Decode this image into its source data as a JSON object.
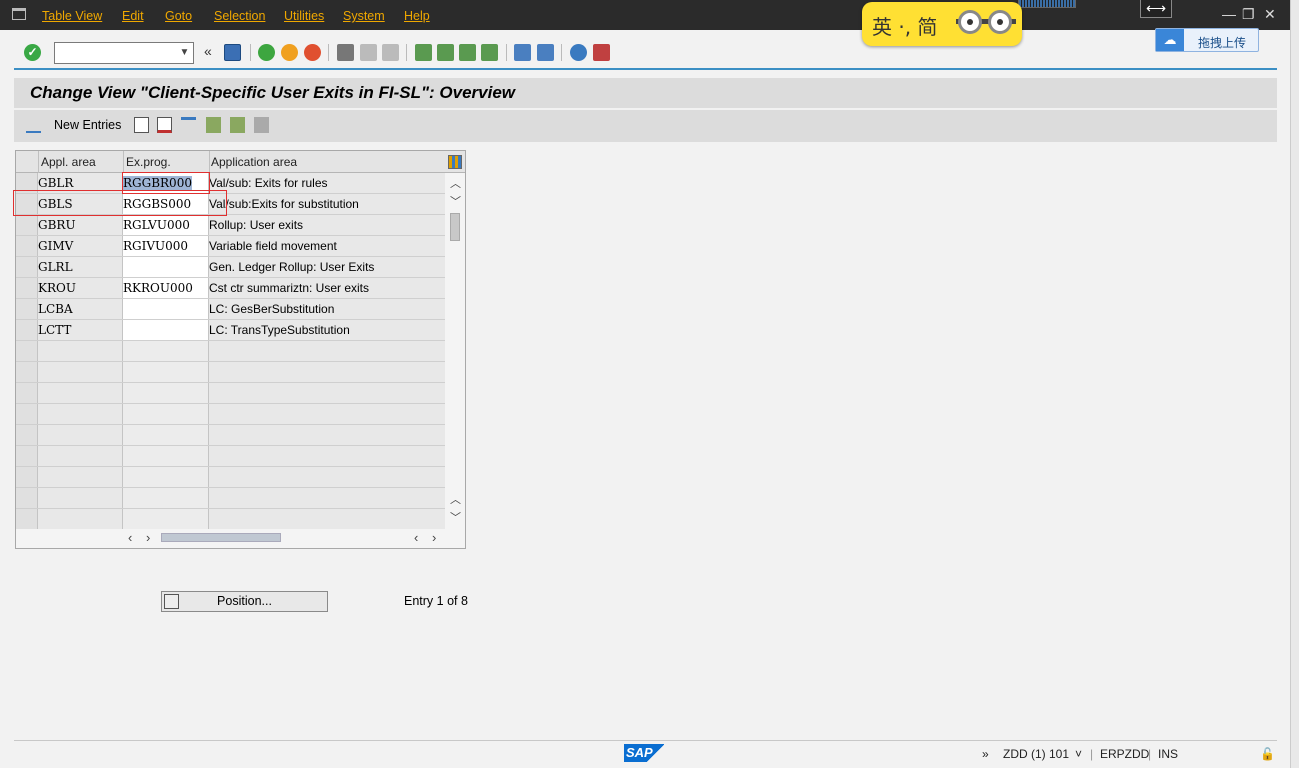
{
  "menu": [
    "Table View",
    "Edit",
    "Goto",
    "Selection",
    "Utilities",
    "System",
    "Help"
  ],
  "ime": {
    "text": "英 ·, 简"
  },
  "upload": {
    "label": "拖拽上传"
  },
  "toolbar": {
    "command_field": ""
  },
  "title": "Change View \"Client-Specific User Exits in FI-SL\": Overview",
  "app_toolbar": {
    "new_entries": "New Entries"
  },
  "table": {
    "columns": [
      "Appl. area",
      "Ex.prog.",
      "Application area"
    ],
    "rows": [
      {
        "appl_area": "GBLR",
        "ex_prog": "RGGBR000",
        "desc": "Val/sub: Exits for rules"
      },
      {
        "appl_area": "GBLS",
        "ex_prog": "RGGBS000",
        "desc": "Val/sub:Exits for substitution"
      },
      {
        "appl_area": "GBRU",
        "ex_prog": "RGLVU000",
        "desc": "Rollup: User exits"
      },
      {
        "appl_area": "GIMV",
        "ex_prog": "RGIVU000",
        "desc": "Variable field movement"
      },
      {
        "appl_area": "GLRL",
        "ex_prog": "",
        "desc": "Gen. Ledger Rollup: User Exits"
      },
      {
        "appl_area": "KROU",
        "ex_prog": "RKROU000",
        "desc": "Cst ctr summariztn: User exits"
      },
      {
        "appl_area": "LCBA",
        "ex_prog": "",
        "desc": "LC: GesBerSubstitution"
      },
      {
        "appl_area": "LCTT",
        "ex_prog": "",
        "desc": "LC: TransTypeSubstitution"
      }
    ]
  },
  "position_button": "Position...",
  "entry_info": "Entry 1 of 8",
  "status": {
    "sap": "SAP",
    "chevrons": "»",
    "system": "ZDD (1) 101",
    "server": "ERPZDD",
    "mode": "INS"
  },
  "colors": {
    "menu_text": "#f0a800",
    "accent": "#3c8fc4",
    "highlight": "#9fb5d5",
    "red_frame": "#e03030"
  }
}
